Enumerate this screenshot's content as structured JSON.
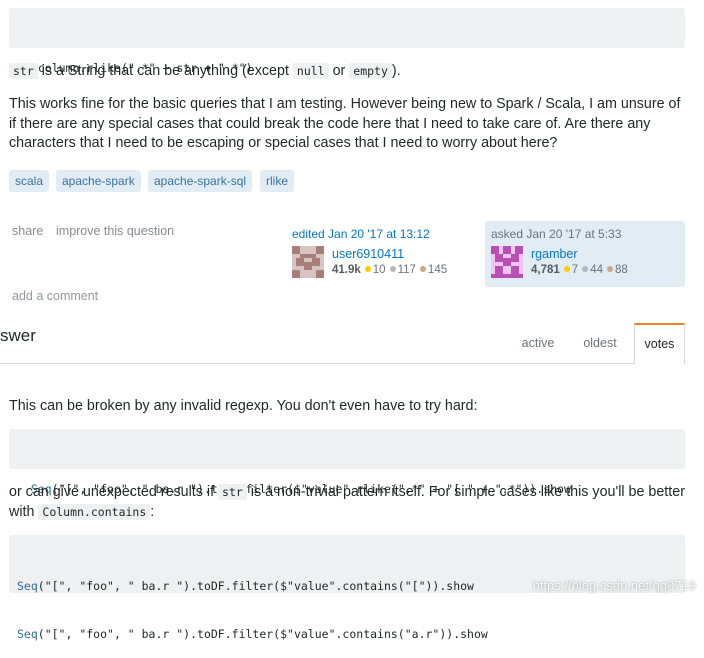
{
  "question": {
    "code_top": "column.rlike(\".*\" + str + \".*\")",
    "p1": {
      "code_str": "str",
      "text_a": " is a String that can be anything (except ",
      "code_null": "null",
      "text_or": " or ",
      "code_empty": "empty",
      "text_end": ")."
    },
    "p2": "This works fine for the basic queries that I am testing. However being new to Spark / Scala, I am unsure of if there are any special cases that could break the code here that I need to take care of. Are there any characters that I need to be escaping or special cases that I need to worry about here?",
    "tags": [
      "scala",
      "apache-spark",
      "apache-spark-sql",
      "rlike"
    ],
    "actions": {
      "share": "share",
      "improve": "improve this question"
    },
    "edited": {
      "label": "edited Jan 20 '17 at 13:12",
      "user": "user6910411",
      "rep": "41.9k",
      "gold": "10",
      "silver": "117",
      "bronze": "145"
    },
    "asked": {
      "label": "asked Jan 20 '17 at 5:33",
      "user": "rgamber",
      "rep": "4,781",
      "gold": "7",
      "silver": "44",
      "bronze": "88"
    },
    "add_comment": "add a comment"
  },
  "answers_header": {
    "title": "swer",
    "tabs": [
      "active",
      "oldest",
      "votes"
    ],
    "active_tab": "votes"
  },
  "answer": {
    "p1": "This can be broken by any invalid regexp. You don't even have to try hard:",
    "code1": {
      "kw": "Seq",
      "rest": "(\"[\", \"foo\", \" ba.r \").toDF.filter($\"value\".rlike(\".*\" + \"[ \" + \".*\")).show"
    },
    "p2": {
      "text_a": "or can give unexpected results if ",
      "code_str": "str",
      "text_b": " is a non-trivial pattern itself. For simple cases like this you'll be better with ",
      "code_contains": "Column.contains",
      "text_end": ":"
    },
    "code2_line1": {
      "kw": "Seq",
      "rest": "(\"[\", \"foo\", \" ba.r \").toDF.filter($\"value\".contains(\"[\")).show"
    },
    "code2_line2": {
      "kw": "Seq",
      "rest": "(\"[\", \"foo\", \" ba.r \").toDF.filter($\"value\".contains(\"a.r\")).show"
    }
  },
  "watermark": "https://blog.csdn.net/qq0719"
}
